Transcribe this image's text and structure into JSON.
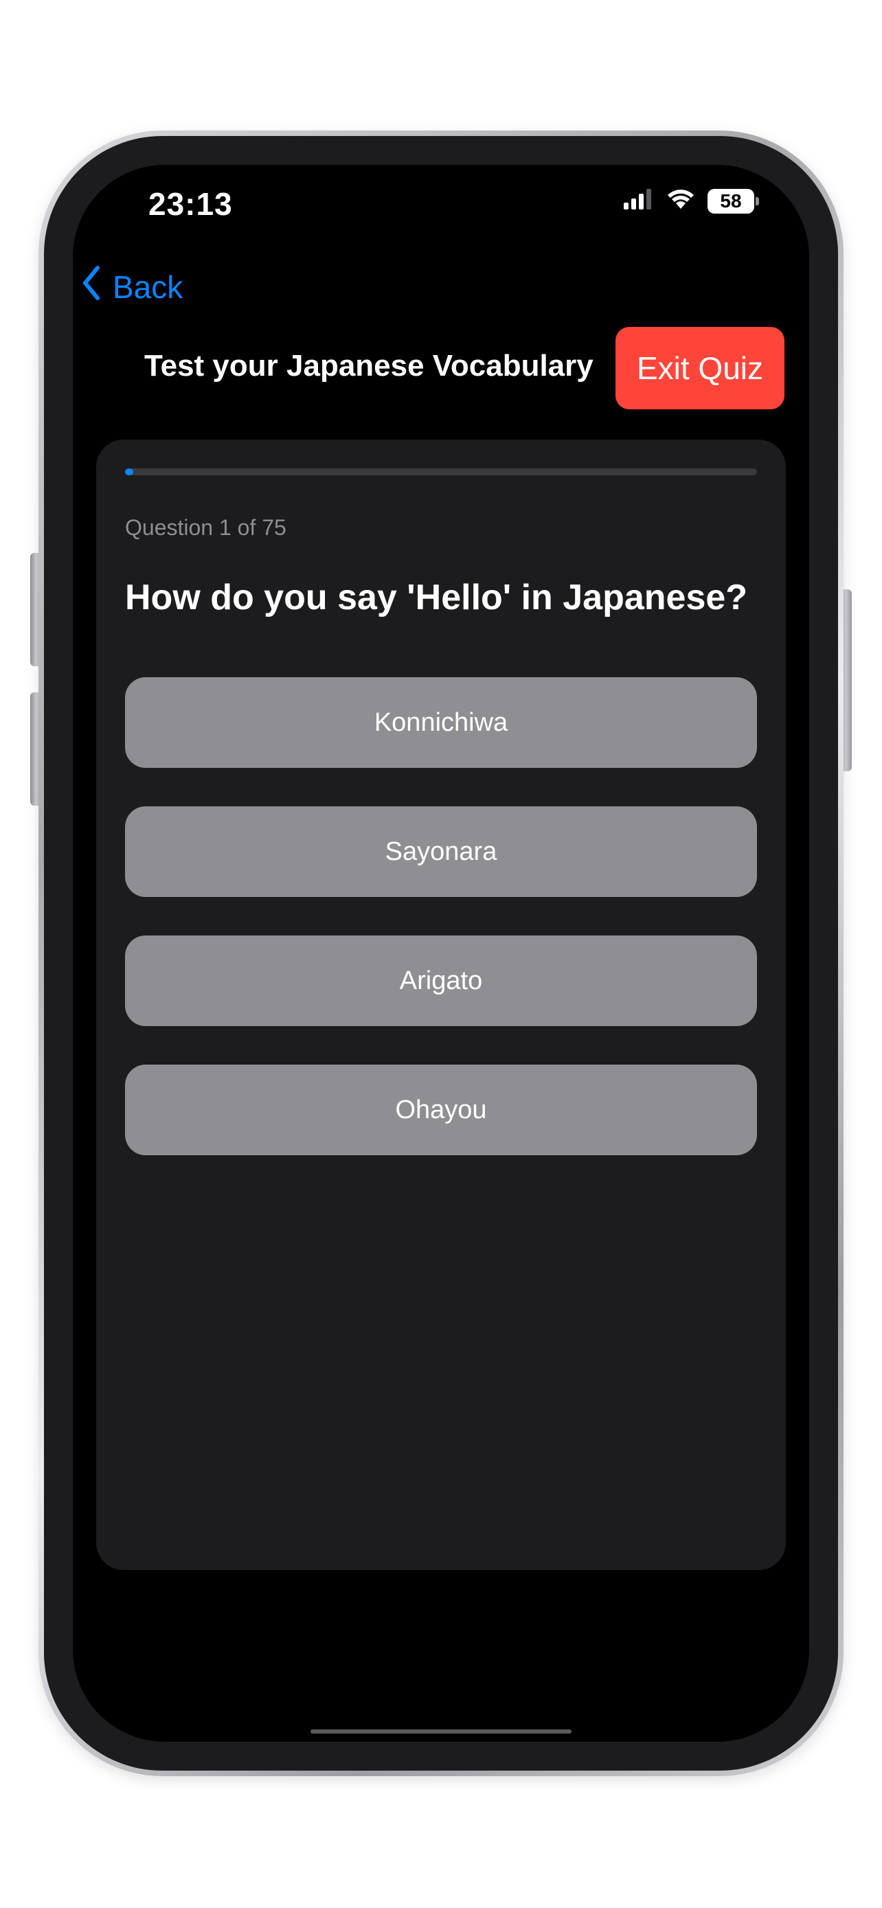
{
  "status_bar": {
    "time": "23:13",
    "battery": "58",
    "signal_icon": "cellular-signal-icon",
    "wifi_icon": "wifi-icon"
  },
  "nav": {
    "back_label": "Back",
    "back_icon": "chevron-left-icon"
  },
  "header": {
    "title": "Test your Japanese Vocabulary",
    "exit_label": "Exit Quiz"
  },
  "quiz": {
    "progress": 0.0133,
    "counter": "Question 1 of 75",
    "question": "How do you say 'Hello' in Japanese?",
    "options": [
      {
        "label": "Konnichiwa"
      },
      {
        "label": "Sayonara"
      },
      {
        "label": "Arigato"
      },
      {
        "label": "Ohayou"
      }
    ]
  },
  "colors": {
    "accent": "#0a84ff",
    "destructive": "#ff453a",
    "card_bg": "#1c1c1e",
    "option_bg": "#8e8e93",
    "screen_bg": "#000000"
  }
}
